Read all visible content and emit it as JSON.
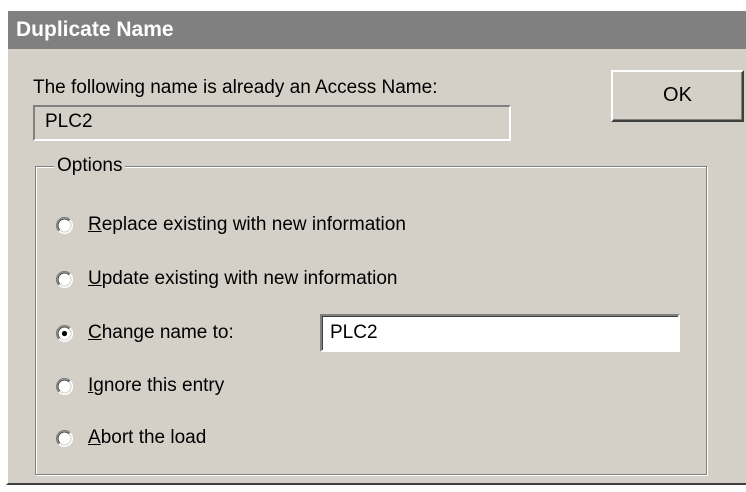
{
  "dialog": {
    "title": "Duplicate Name",
    "prompt": "The following name is already an Access Name:",
    "existing_name": "PLC2",
    "ok_label": "OK"
  },
  "options": {
    "group_label": "Options",
    "items": [
      {
        "mnemonic": "R",
        "rest": "eplace existing with new information",
        "selected": false
      },
      {
        "mnemonic": "U",
        "rest": "pdate existing with new information",
        "selected": false
      },
      {
        "mnemonic": "C",
        "rest": "hange name to:",
        "selected": true
      },
      {
        "mnemonic": "I",
        "rest": "gnore this entry",
        "selected": false
      },
      {
        "mnemonic": "A",
        "rest": "bort the load",
        "selected": false
      }
    ],
    "new_name_value": "PLC2"
  },
  "colors": {
    "face": "#d4d0c8",
    "titlebar": "#808080",
    "title_text": "#ffffff"
  },
  "icons": {
    "radio": "radio-button-icon"
  }
}
